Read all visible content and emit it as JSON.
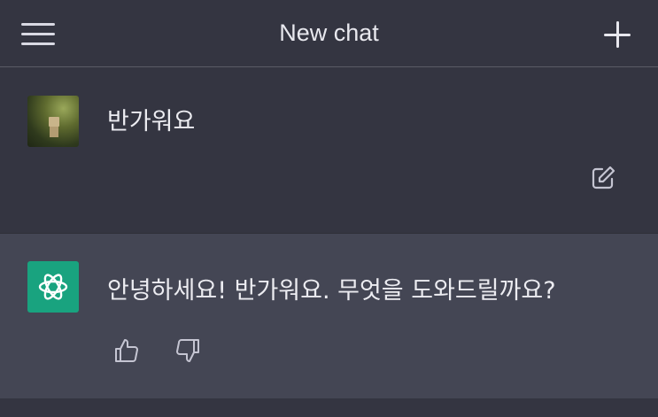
{
  "header": {
    "title": "New chat",
    "menu_icon": "hamburger-menu-icon",
    "new_chat_icon": "plus-icon"
  },
  "conversation": {
    "user_message": {
      "text": "반가워요",
      "avatar": "user-avatar",
      "edit_icon": "edit-icon"
    },
    "assistant_message": {
      "text": "안녕하세요! 반가워요. 무엇을 도와드릴까요?",
      "avatar": "openai-logo-icon",
      "feedback_icons": [
        "thumbs-up-icon",
        "thumbs-down-icon"
      ]
    }
  },
  "colors": {
    "background": "#343541",
    "assistant_background": "#444654",
    "accent": "#19a37f",
    "text": "#ececf1"
  }
}
